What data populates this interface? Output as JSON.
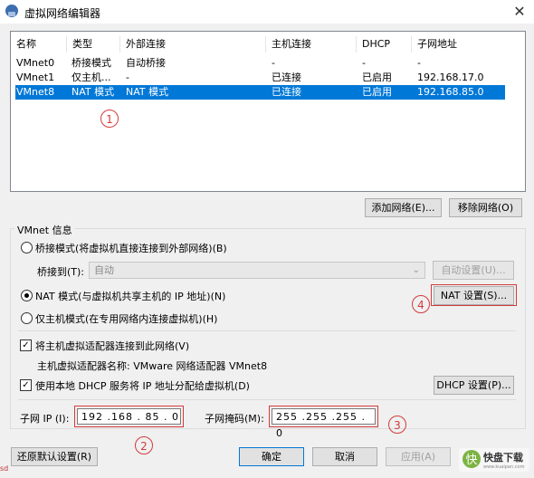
{
  "window": {
    "title": "虚拟网络编辑器",
    "close_symbol": "✕"
  },
  "list": {
    "headers": [
      "名称",
      "类型",
      "外部连接",
      "主机连接",
      "DHCP",
      "子网地址"
    ],
    "rows": [
      {
        "name": "VMnet0",
        "type": "桥接模式",
        "external": "自动桥接",
        "host": "-",
        "dhcp": "-",
        "subnet": "-"
      },
      {
        "name": "VMnet1",
        "type": "仅主机...",
        "external": "-",
        "host": "已连接",
        "dhcp": "已启用",
        "subnet": "192.168.17.0"
      },
      {
        "name": "VMnet8",
        "type": "NAT 模式",
        "external": "NAT 模式",
        "host": "已连接",
        "dhcp": "已启用",
        "subnet": "192.168.85.0"
      }
    ],
    "selected_row": 2
  },
  "buttons": {
    "add_network": "添加网络(E)...",
    "remove_network": "移除网络(O)"
  },
  "vmnet_info": {
    "group_title": "VMnet 信息",
    "bridge_mode": "桥接模式(将虚拟机直接连接到外部网络)(B)",
    "bridge_to_label": "桥接到(T):",
    "bridge_to_value": "自动",
    "auto_settings": "自动设置(U)...",
    "nat_mode": "NAT 模式(与虚拟机共享主机的 IP 地址)(N)",
    "nat_settings": "NAT 设置(S)...",
    "host_only_mode": "仅主机模式(在专用网络内连接虚拟机)(H)",
    "connect_adapter": "将主机虚拟适配器连接到此网络(V)",
    "adapter_name": "主机虚拟适配器名称: VMware 网络适配器 VMnet8",
    "use_dhcp": "使用本地 DHCP 服务将 IP 地址分配给虚拟机(D)",
    "dhcp_settings": "DHCP 设置(P)...",
    "subnet_ip_label": "子网 IP (I):",
    "subnet_ip_value": "192 .168 . 85 . 0",
    "subnet_mask_label": "子网掩码(M):",
    "subnet_mask_value": "255 .255 .255 . 0"
  },
  "footer": {
    "restore_defaults": "还原默认设置(R)",
    "ok": "确定",
    "cancel": "取消",
    "apply": "应用(A)",
    "help": "帮助"
  },
  "annotations": {
    "one": "1",
    "two": "2",
    "three": "3",
    "four": "4"
  },
  "watermark": {
    "text": "快盘下载",
    "sub": "www.kuaipan.com",
    "accent": "#7cb342"
  },
  "corner_text": "sd"
}
